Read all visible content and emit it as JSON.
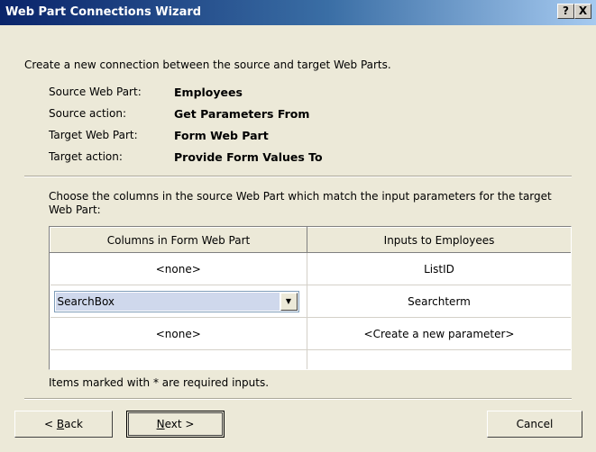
{
  "window": {
    "title": "Web Part Connections Wizard",
    "help_label": "?",
    "close_label": "X"
  },
  "intro": "Create a new connection between the source and target Web Parts.",
  "summary": [
    {
      "label": "Source Web Part:",
      "value": "Employees"
    },
    {
      "label": "Source action:",
      "value": "Get Parameters From"
    },
    {
      "label": "Target Web Part:",
      "value": "Form Web Part"
    },
    {
      "label": "Target action:",
      "value": "Provide Form Values To"
    }
  ],
  "instruction": "Choose the columns in the source Web Part which match the input parameters for the target Web Part:",
  "grid": {
    "headers": [
      "Columns in Form Web Part",
      "Inputs to Employees"
    ],
    "rows": [
      {
        "column": "<none>",
        "input": "ListID"
      },
      {
        "column": "SearchBox",
        "input": "Searchterm"
      },
      {
        "column": "<none>",
        "input": "<Create a new parameter>"
      },
      {
        "column": "",
        "input": ""
      }
    ]
  },
  "note": "Items marked with * are required inputs.",
  "buttons": {
    "back_prefix": "< ",
    "back_mnemonic": "B",
    "back_rest": "ack",
    "next_mnemonic": "N",
    "next_rest": "ext >",
    "cancel": "Cancel"
  }
}
